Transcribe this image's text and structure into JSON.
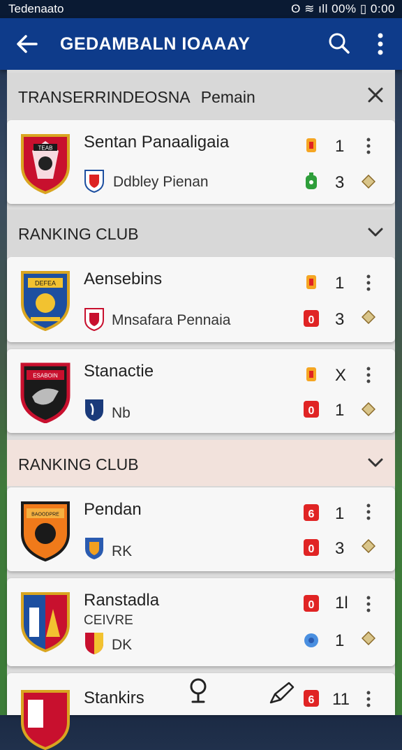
{
  "status_bar": {
    "left_text": "Tedenaato",
    "right_text": "ʘ ≋ ıll 00% ▯ 0:00"
  },
  "app_bar": {
    "title": "GEDAMBALN IOAAAY"
  },
  "sections": [
    {
      "title_main": "TRANSERRINDEOSNA",
      "title_suffix": "Pemain",
      "control": "close-icon"
    },
    {
      "title": "RANKING CLUB",
      "control": "chevron-down-icon"
    },
    {
      "title": "RANKING CLUB",
      "control": "chevron-down-icon"
    }
  ],
  "cards": [
    {
      "name": "Sentan Panaaligaia",
      "crest_text": "TEAB",
      "sub": "Ddbley Pienan",
      "stat1": "1",
      "stat2": "3"
    },
    {
      "name": "Aensebins",
      "crest_text": "DEFEA",
      "sub": "Mnsafara Pennaia",
      "stat1": "1",
      "stat2": "3"
    },
    {
      "name": "Stanactie",
      "crest_text": "ESABOIN",
      "sub": "Nb",
      "stat1": "X",
      "stat2": "1"
    },
    {
      "name": "Pendan",
      "crest_text": "BAOODPRE",
      "sub": "RK",
      "stat1": "1",
      "stat2": "3"
    },
    {
      "name": "Ranstadla",
      "name2": "CEIVRE",
      "sub": "DK",
      "stat1": "1l",
      "stat2": "1"
    },
    {
      "name": "Stankirs",
      "stat1": "11"
    }
  ],
  "badges": {
    "b": "0",
    "c": "6"
  },
  "colors": {
    "app_bar": "#0e3b8a",
    "status_bar": "#0a1a33",
    "badge_red": "#e02424",
    "ranking_header_tint": "#f2e2dc"
  }
}
